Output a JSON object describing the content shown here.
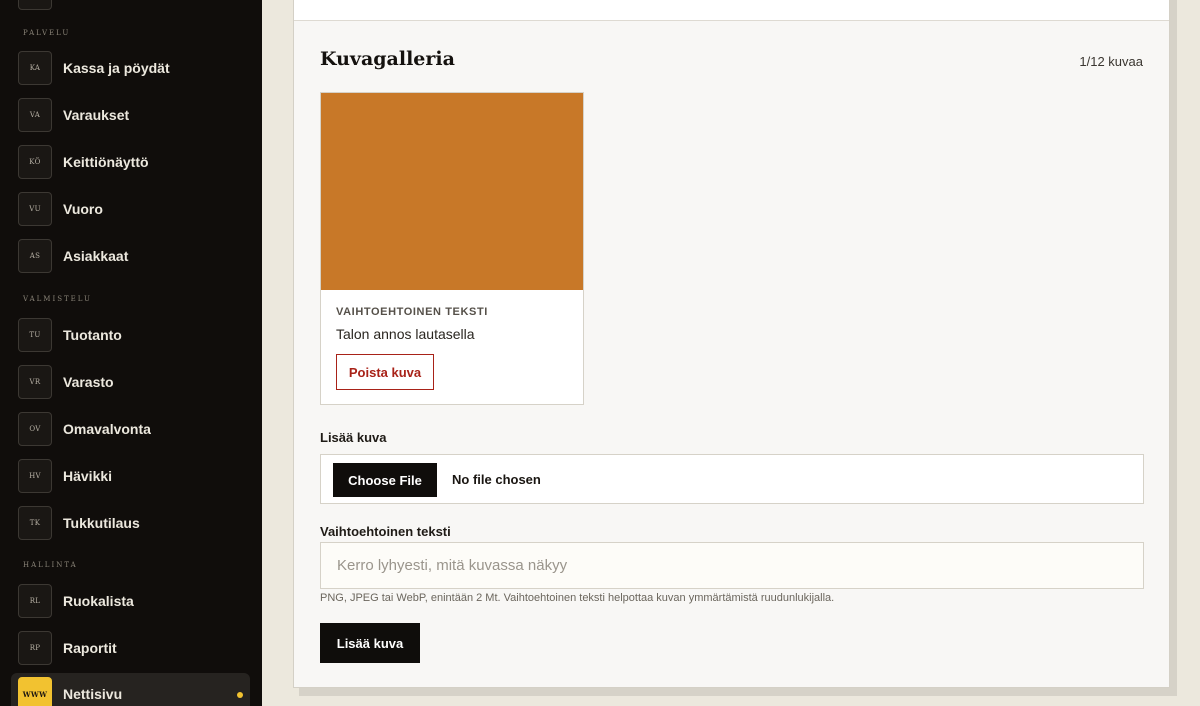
{
  "sidebar": {
    "sections": [
      {
        "label": "PALVELU"
      },
      {
        "label": "VALMISTELU"
      },
      {
        "label": "HALLINTA"
      }
    ],
    "items": [
      {
        "badge": "KA",
        "label": "Kassa ja pöydät"
      },
      {
        "badge": "VA",
        "label": "Varaukset"
      },
      {
        "badge": "KÖ",
        "label": "Keittiönäyttö"
      },
      {
        "badge": "VU",
        "label": "Vuoro"
      },
      {
        "badge": "AS",
        "label": "Asiakkaat"
      },
      {
        "badge": "TU",
        "label": "Tuotanto"
      },
      {
        "badge": "VR",
        "label": "Varasto"
      },
      {
        "badge": "OV",
        "label": "Omavalvonta"
      },
      {
        "badge": "HV",
        "label": "Hävikki"
      },
      {
        "badge": "TK",
        "label": "Tukkutilaus"
      },
      {
        "badge": "RL",
        "label": "Ruokalista"
      },
      {
        "badge": "RP",
        "label": "Raportit"
      },
      {
        "badge": "WWW",
        "label": "Nettisivu",
        "active": true
      }
    ]
  },
  "gallery": {
    "title": "Kuvagalleria",
    "count": "1/12 kuvaa",
    "images": [
      {
        "color": "#c87828",
        "alt_caption": "Vaihtoehtoinen teksti",
        "alt_text": "Talon annos lautasella",
        "delete_label": "Poista kuva"
      }
    ]
  },
  "upload": {
    "file_label": "Lisää kuva",
    "choose_file_label": "Choose File",
    "file_status": "No file chosen",
    "alt_label": "Vaihtoehtoinen teksti",
    "alt_placeholder": "Kerro lyhyesti, mitä kuvassa näkyy",
    "help_text": "PNG, JPEG tai WebP, enintään 2 Mt. Vaihtoehtoinen teksti helpottaa kuvan ymmärtämistä ruudunlukijalla.",
    "submit_label": "Lisää kuva"
  },
  "colors": {
    "sidebar_bg": "#100d0b",
    "accent": "#f2c230",
    "danger": "#a82218",
    "page_bg": "#ece8dd"
  }
}
